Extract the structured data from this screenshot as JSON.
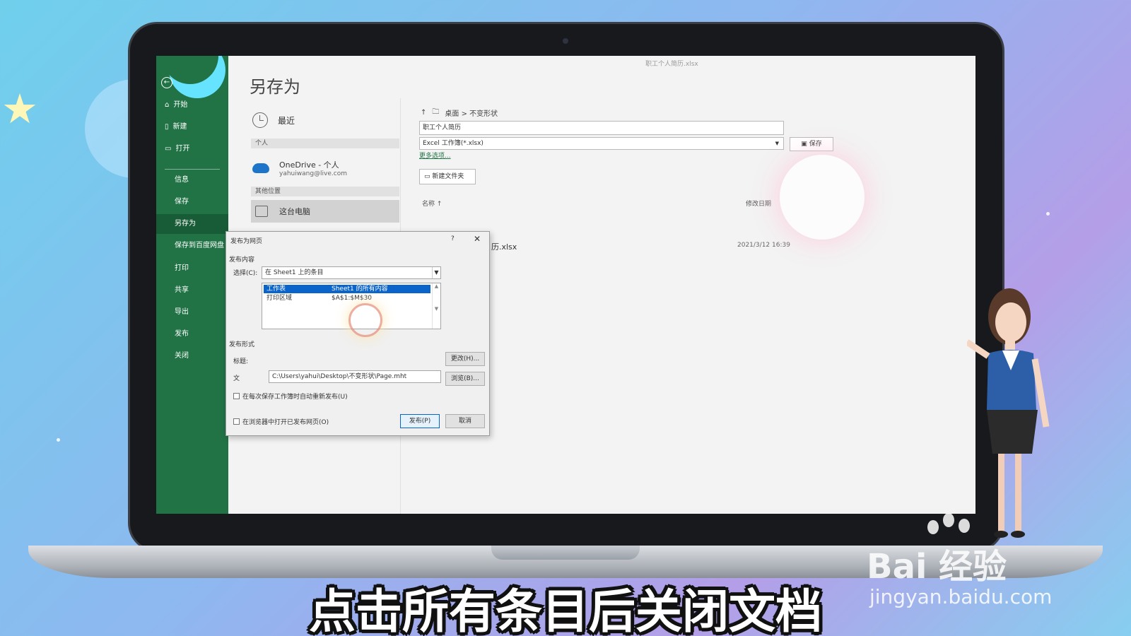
{
  "window": {
    "doc_title": "职工个人简历.xlsx"
  },
  "sidebar": {
    "items": [
      {
        "label": "开始",
        "icon": "home-icon"
      },
      {
        "label": "新建",
        "icon": "new-file-icon"
      },
      {
        "label": "打开",
        "icon": "folder-open-icon"
      },
      {
        "label": "信息"
      },
      {
        "label": "保存"
      },
      {
        "label": "另存为"
      },
      {
        "label": "保存到百度网盘"
      },
      {
        "label": "打印"
      },
      {
        "label": "共享"
      },
      {
        "label": "导出"
      },
      {
        "label": "发布"
      },
      {
        "label": "关闭"
      }
    ]
  },
  "saveas": {
    "title": "另存为",
    "recent": "最近",
    "personal_header": "个人",
    "onedrive_name": "OneDrive - 个人",
    "onedrive_email": "yahuiwang@live.com",
    "other_header": "其他位置",
    "this_pc": "这台电脑",
    "breadcrumb": "桌面 > 不变形状",
    "filename": "职工个人简历",
    "filetype": "Excel 工作簿(*.xlsx)",
    "save_label": "保存",
    "more_options": "更多选项...",
    "new_folder": "新建文件夹",
    "col_name": "名称 ↑",
    "col_date": "修改日期",
    "file_name": "历.xlsx",
    "file_date": "2021/3/12 16:39"
  },
  "dialog": {
    "title": "发布为网页",
    "help": "?",
    "close": "✕",
    "publish_section": "发布内容",
    "select_label": "选择(C):",
    "select_value": "在 Sheet1 上的条目",
    "list": [
      {
        "c1": "工作表",
        "c2": "Sheet1 的所有内容",
        "selected": true
      },
      {
        "c1": "打印区域",
        "c2": "$A$1:$M$30",
        "selected": false
      }
    ],
    "format_section": "发布形式",
    "title_label": "标题:",
    "change_button": "更改(H)...",
    "file_label": "文",
    "path": "C:\\Users\\yahui\\Desktop\\不变形状\\Page.mht",
    "browse_button": "浏览(B)...",
    "autorepublish": "在每次保存工作簿时自动重新发布(U)",
    "open_in_browser": "在浏览器中打开已发布网页(O)",
    "publish_button": "发布(P)",
    "cancel_button": "取消"
  },
  "overlay": {
    "subtitle": "点击所有条目后关闭文档",
    "watermark": "Bai 经验",
    "watermark_url": "jingyan.baidu.com"
  }
}
